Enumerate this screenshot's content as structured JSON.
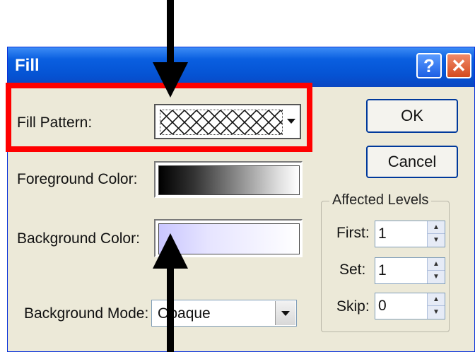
{
  "window": {
    "title": "Fill",
    "help_glyph": "?",
    "close_glyph": "✕"
  },
  "fields": {
    "fill_pattern_label": "Fill Pattern:",
    "foreground_color_label": "Foreground Color:",
    "background_color_label": "Background Color:",
    "background_mode_label": "Background Mode:",
    "background_mode_value": "Opaque"
  },
  "buttons": {
    "ok": "OK",
    "cancel": "Cancel"
  },
  "affected_levels": {
    "title": "Affected Levels",
    "first_label": "First:",
    "first_value": "1",
    "set_label": "Set:",
    "set_value": "1",
    "skip_label": "Skip:",
    "skip_value": "0"
  },
  "colors": {
    "highlight": "#ff0000",
    "title_bar": "#0553d3",
    "foreground_swatch": "black-to-white gradient",
    "background_swatch": "#d9d6ff"
  },
  "icons": [
    "question-mark-icon",
    "close-x-icon",
    "dropdown-arrow-icon",
    "spin-up-icon",
    "spin-down-icon",
    "down-arrow-annotation",
    "up-arrow-annotation"
  ]
}
